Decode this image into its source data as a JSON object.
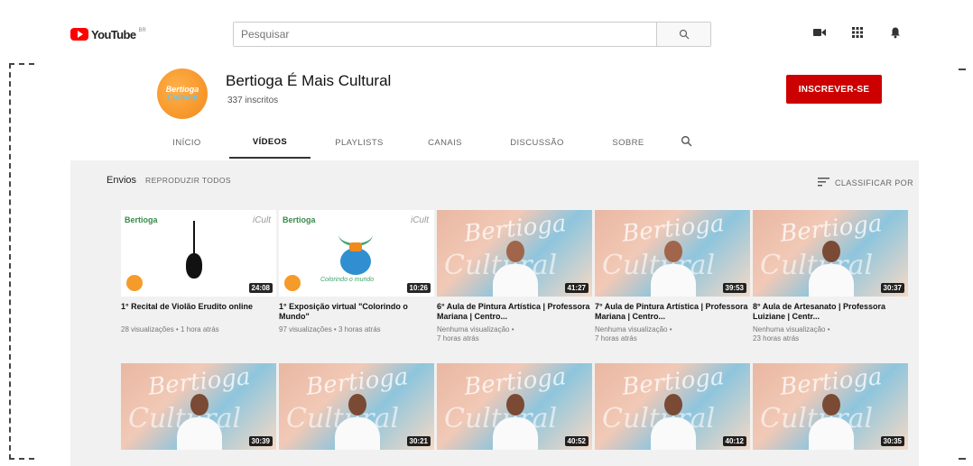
{
  "topbar": {
    "logo_text": "YouTube",
    "logo_region": "BR",
    "search_placeholder": "Pesquisar",
    "icons": [
      "search-icon",
      "video-camera-icon",
      "apps-grid-icon",
      "bell-icon"
    ]
  },
  "channel": {
    "avatar_text_1": "Bertioga",
    "avatar_text_2": "Cultural",
    "name": "Bertioga É Mais Cultural",
    "subscribers": "337 inscritos",
    "subscribe_label": "INSCREVER-SE",
    "accent": "#cc0000"
  },
  "tabs": [
    "INÍCIO",
    "VÍDEOS",
    "PLAYLISTS",
    "CANAIS",
    "DISCUSSÃO",
    "SOBRE"
  ],
  "section": {
    "title": "Envios",
    "play_all": "REPRODUZIR TODOS",
    "sort_label": "CLASSIFICAR POR"
  },
  "videos": [
    {
      "title": "1° Recital de Violão Erudito online",
      "meta": "28 visualizações • 1 hora atrás",
      "duration": "24:08",
      "thumb": "guitar"
    },
    {
      "title": "1° Exposição virtual \"Colorindo o Mundo\"",
      "meta": "97 visualizações • 3 horas atrás",
      "duration": "10:26",
      "thumb": "exhibit"
    },
    {
      "title": "6° Aula de Pintura Artística | Professora Mariana | Centro...",
      "meta": "Nenhuma visualização •\n7 horas atrás",
      "duration": "41:27",
      "thumb": "art"
    },
    {
      "title": "7° Aula de Pintura Artística | Professora Mariana | Centro...",
      "meta": "Nenhuma visualização •\n7 horas atrás",
      "duration": "39:53",
      "thumb": "art"
    },
    {
      "title": "8° Aula de Artesanato | Professora Luiziane | Centr...",
      "meta": "Nenhuma visualização •\n23 horas atrás",
      "duration": "30:37",
      "thumb": "art"
    },
    {
      "duration": "30:39",
      "thumb": "art"
    },
    {
      "duration": "30:21",
      "thumb": "art"
    },
    {
      "duration": "40:52",
      "thumb": "art"
    },
    {
      "duration": "40:12",
      "thumb": "art"
    },
    {
      "duration": "30:35",
      "thumb": "art"
    }
  ],
  "thumb_text": {
    "brand": "Bertioga",
    "icult": "iCult",
    "exhibit_caption": "Colorindo o mundo",
    "script_1": "Bertioga",
    "script_2": "Cultural"
  }
}
